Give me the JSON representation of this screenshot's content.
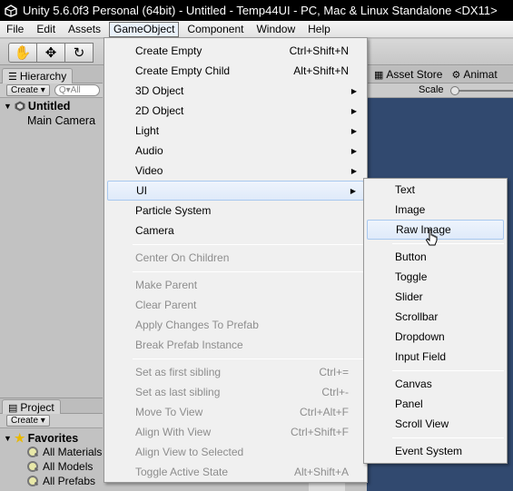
{
  "window": {
    "title": "Unity 5.6.0f3 Personal (64bit) - Untitled - Temp44UI - PC, Mac & Linux Standalone <DX11>"
  },
  "menubar": {
    "items": [
      "File",
      "Edit",
      "Assets",
      "GameObject",
      "Component",
      "Window",
      "Help"
    ]
  },
  "toolbar": {
    "tools": [
      "hand-tool-icon",
      "move-tool-icon",
      "rotate-tool-icon"
    ]
  },
  "hierarchy": {
    "tab_label": "Hierarchy",
    "create_label": "Create",
    "search_placeholder": "Q▾All",
    "scene_name": "Untitled",
    "items": [
      "Main Camera"
    ]
  },
  "right_panel": {
    "asset_store_label": "Asset Store",
    "animator_label": "Animat",
    "scale_label": "Scale"
  },
  "project": {
    "tab_label": "Project",
    "create_label": "Create",
    "favorites_label": "Favorites",
    "favorites": [
      "All Materials",
      "All Models",
      "All Prefabs"
    ]
  },
  "gameobject_menu": {
    "items": [
      {
        "label": "Create Empty",
        "shortcut": "Ctrl+Shift+N"
      },
      {
        "label": "Create Empty Child",
        "shortcut": "Alt+Shift+N"
      },
      {
        "label": "3D Object",
        "submenu": true
      },
      {
        "label": "2D Object",
        "submenu": true
      },
      {
        "label": "Light",
        "submenu": true
      },
      {
        "label": "Audio",
        "submenu": true
      },
      {
        "label": "Video",
        "submenu": true
      },
      {
        "label": "UI",
        "submenu": true,
        "highlighted": true
      },
      {
        "label": "Particle System"
      },
      {
        "label": "Camera"
      },
      {
        "label": "Center On Children",
        "disabled": true
      },
      {
        "label": "Make Parent",
        "disabled": true
      },
      {
        "label": "Clear Parent",
        "disabled": true
      },
      {
        "label": "Apply Changes To Prefab",
        "disabled": true
      },
      {
        "label": "Break Prefab Instance",
        "disabled": true
      },
      {
        "label": "Set as first sibling",
        "shortcut": "Ctrl+=",
        "disabled": true
      },
      {
        "label": "Set as last sibling",
        "shortcut": "Ctrl+-",
        "disabled": true
      },
      {
        "label": "Move To View",
        "shortcut": "Ctrl+Alt+F",
        "disabled": true
      },
      {
        "label": "Align With View",
        "shortcut": "Ctrl+Shift+F",
        "disabled": true
      },
      {
        "label": "Align View to Selected",
        "disabled": true
      },
      {
        "label": "Toggle Active State",
        "shortcut": "Alt+Shift+A",
        "disabled": true
      }
    ]
  },
  "ui_submenu": {
    "items": [
      {
        "label": "Text"
      },
      {
        "label": "Image"
      },
      {
        "label": "Raw Image",
        "highlighted": true
      },
      {
        "label": "Button"
      },
      {
        "label": "Toggle"
      },
      {
        "label": "Slider"
      },
      {
        "label": "Scrollbar"
      },
      {
        "label": "Dropdown"
      },
      {
        "label": "Input Field"
      },
      {
        "label": "Canvas"
      },
      {
        "label": "Panel"
      },
      {
        "label": "Scroll View"
      },
      {
        "label": "Event System"
      }
    ]
  }
}
